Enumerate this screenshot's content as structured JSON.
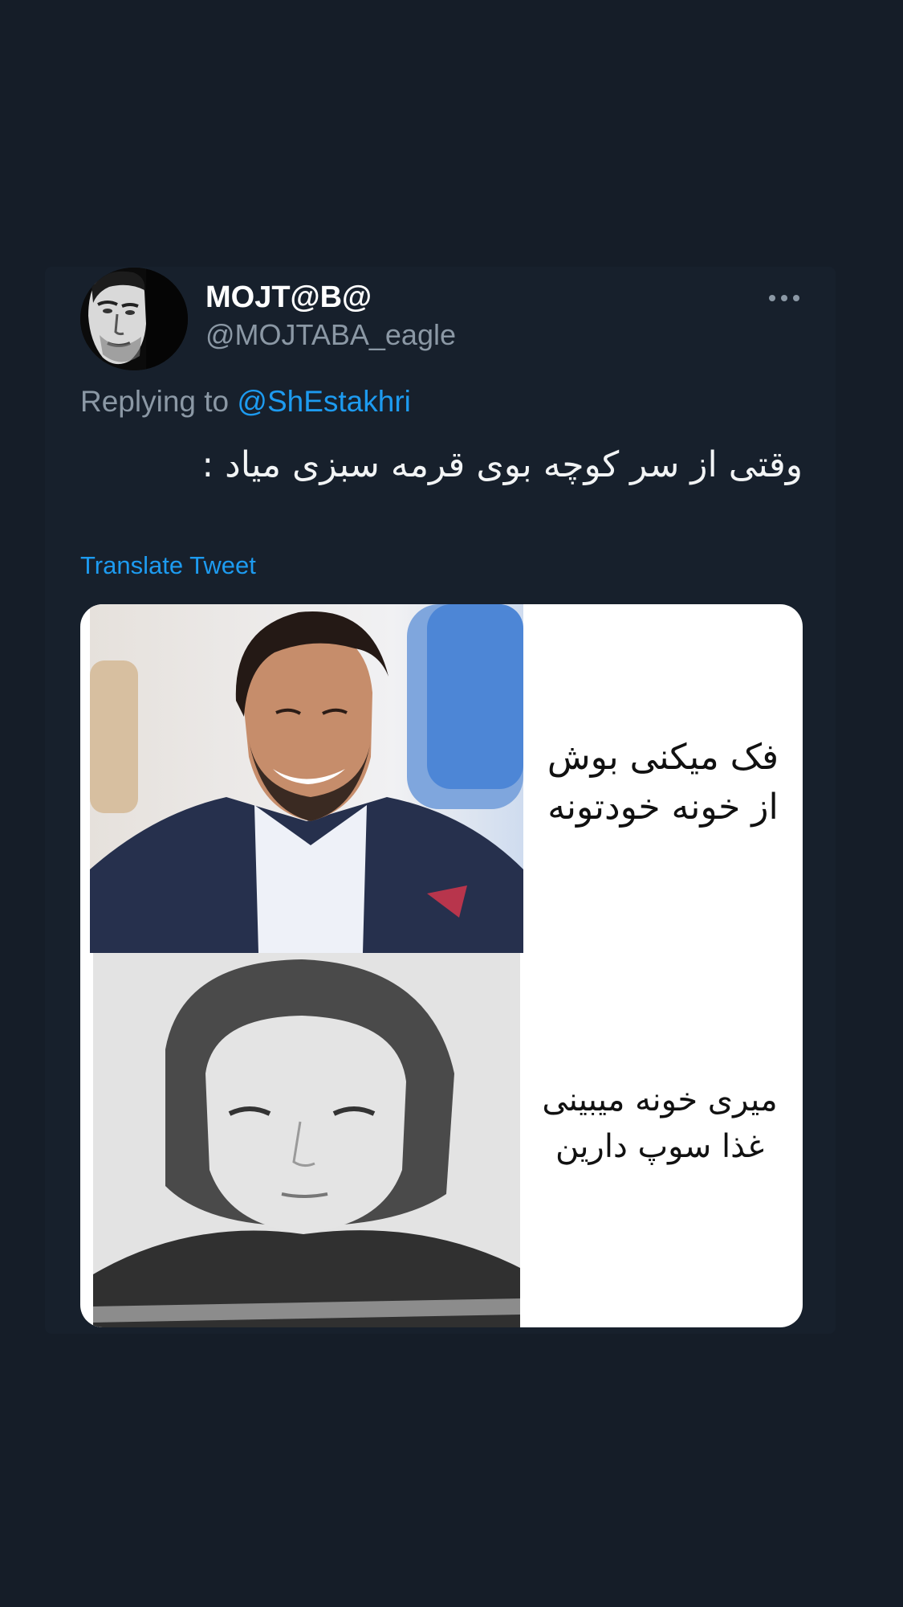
{
  "author": {
    "display_name": "MOJT@B@",
    "handle": "@MOJTABA_eagle"
  },
  "menu": {
    "more_icon": "more-horizontal-icon"
  },
  "reply": {
    "prefix": "Replying to",
    "username": "@ShEstakhri"
  },
  "tweet": {
    "text": "وقتی از سر کوچه بوی قرمه سبزی میاد :"
  },
  "translate": {
    "label": "Translate Tweet"
  },
  "media": {
    "caption_top_line1": "فک میکنی بوش",
    "caption_top_line2": "از خونه خودتونه",
    "caption_bottom_line1": "میری خونه میبینی",
    "caption_bottom_line2": "غذا سوپ دارین"
  },
  "colors": {
    "background": "#151d28",
    "link": "#1d9bf0",
    "secondary_text": "#8b98a5",
    "primary_text": "#ffffff"
  }
}
